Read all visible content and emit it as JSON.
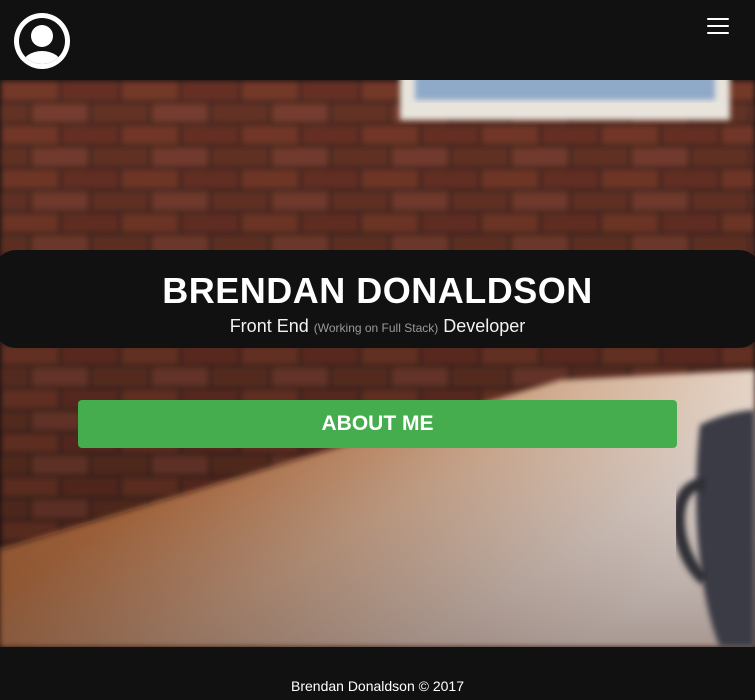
{
  "navbar": {
    "avatar_icon": "user-circle-icon",
    "menu_icon": "hamburger-icon"
  },
  "hero": {
    "name": "BRENDAN DONALDSON",
    "role_prefix": "Front End",
    "role_note": "(Working on Full Stack)",
    "role_suffix": "Developer",
    "about_button_label": "ABOUT ME",
    "about_button_color": "#46ad4f"
  },
  "footer": {
    "text": "Brendan Donaldson © 2017"
  }
}
